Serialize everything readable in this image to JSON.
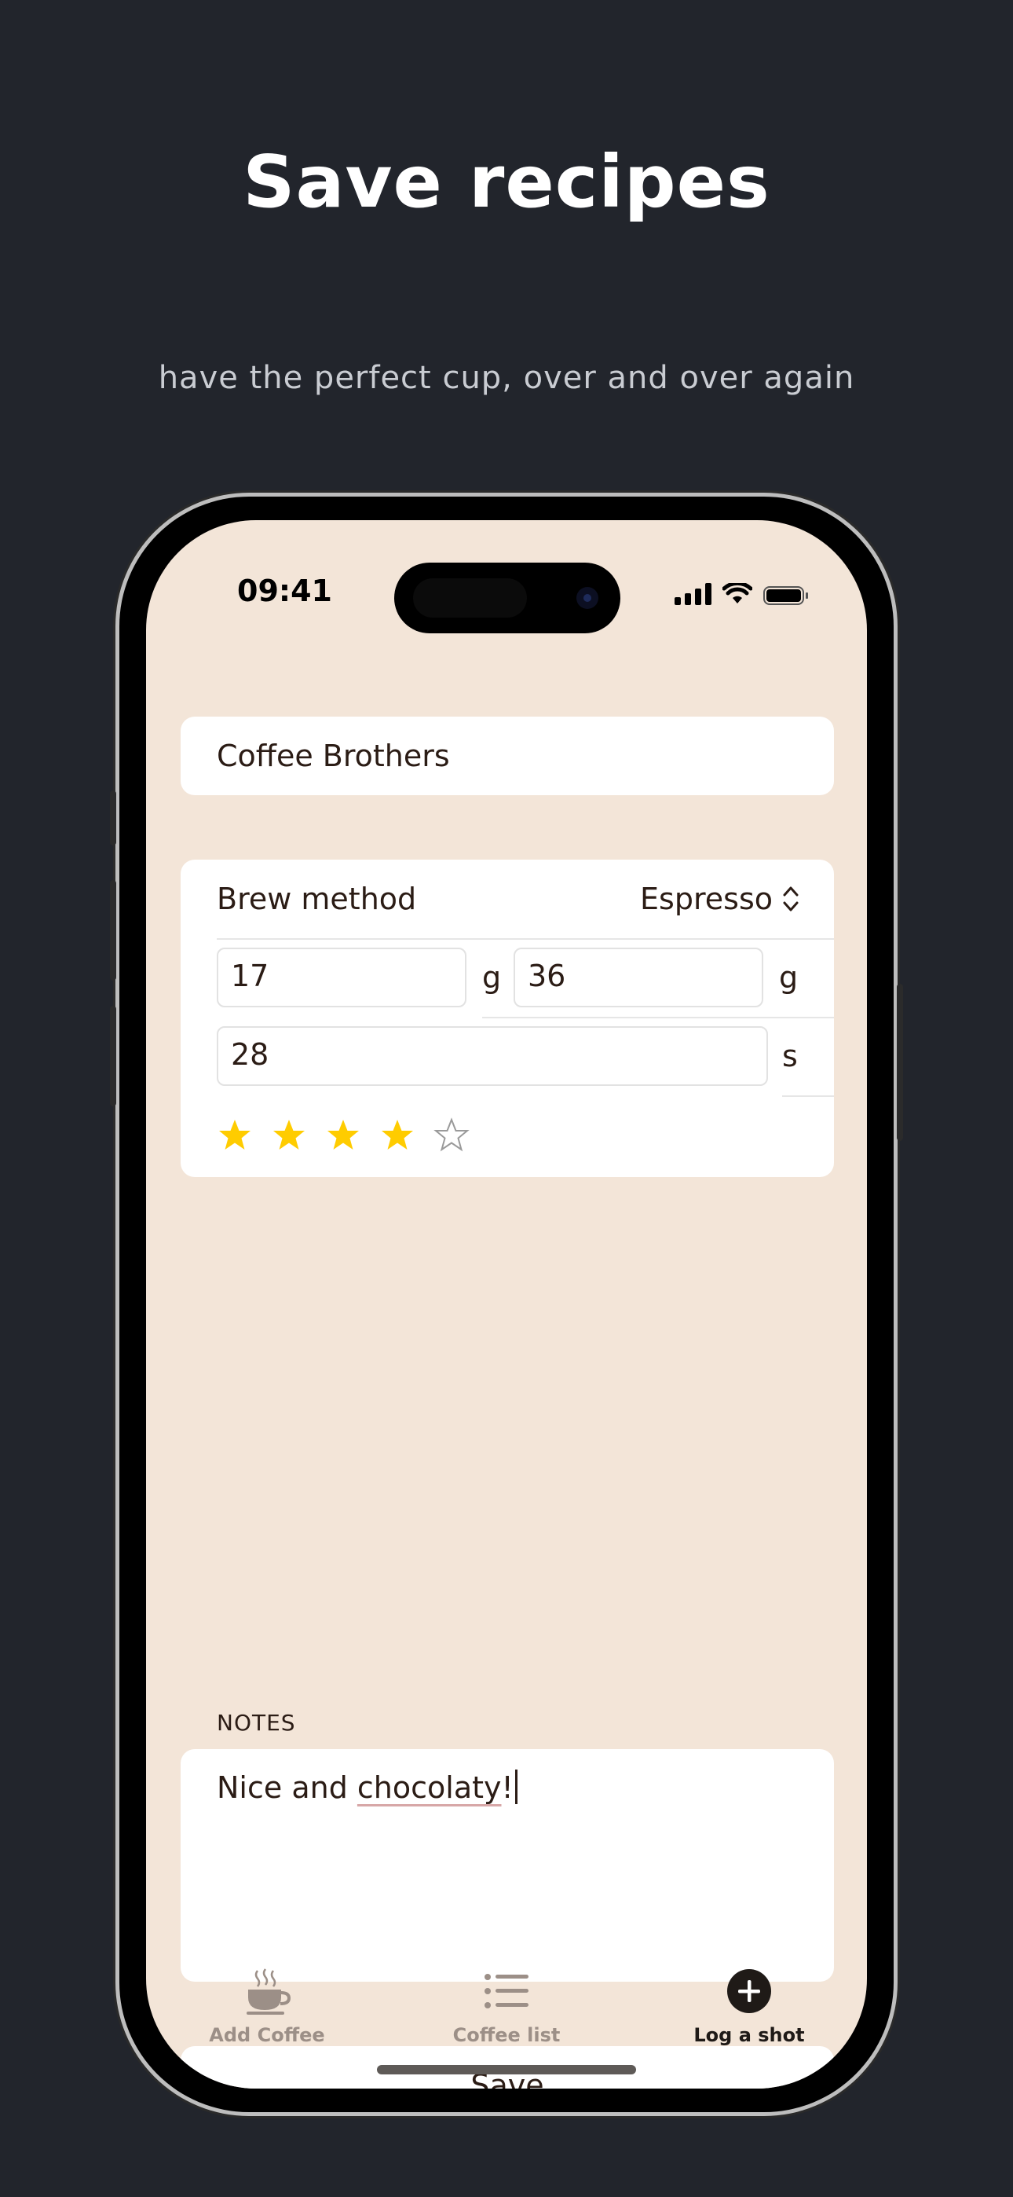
{
  "marketing": {
    "headline": "Save recipes",
    "subline": "have the perfect cup, over and over again"
  },
  "status_bar": {
    "time": "09:41"
  },
  "form": {
    "roaster_value": "Coffee Brothers",
    "brew_method_label": "Brew method",
    "brew_method_value": "Espresso",
    "dose_in": "17",
    "dose_in_unit": "g",
    "dose_out": "36",
    "dose_out_unit": "g",
    "time": "28",
    "time_unit": "s",
    "rating": 4,
    "rating_max": 5,
    "notes_label": "NOTES",
    "notes_text_before": "Nice and ",
    "notes_text_misspelled": "chocolaty",
    "notes_text_after": "!",
    "save_label": "Save"
  },
  "tabs": [
    {
      "label": "Add Coffee",
      "icon": "coffee-cup-icon",
      "active": false
    },
    {
      "label": "Coffee list",
      "icon": "list-icon",
      "active": false
    },
    {
      "label": "Log a shot",
      "icon": "plus-circle-icon",
      "active": true
    }
  ],
  "colors": {
    "background": "#22252c",
    "screen": "#f3e5d8",
    "star": "#ffcc00",
    "text": "#2b1c15"
  }
}
